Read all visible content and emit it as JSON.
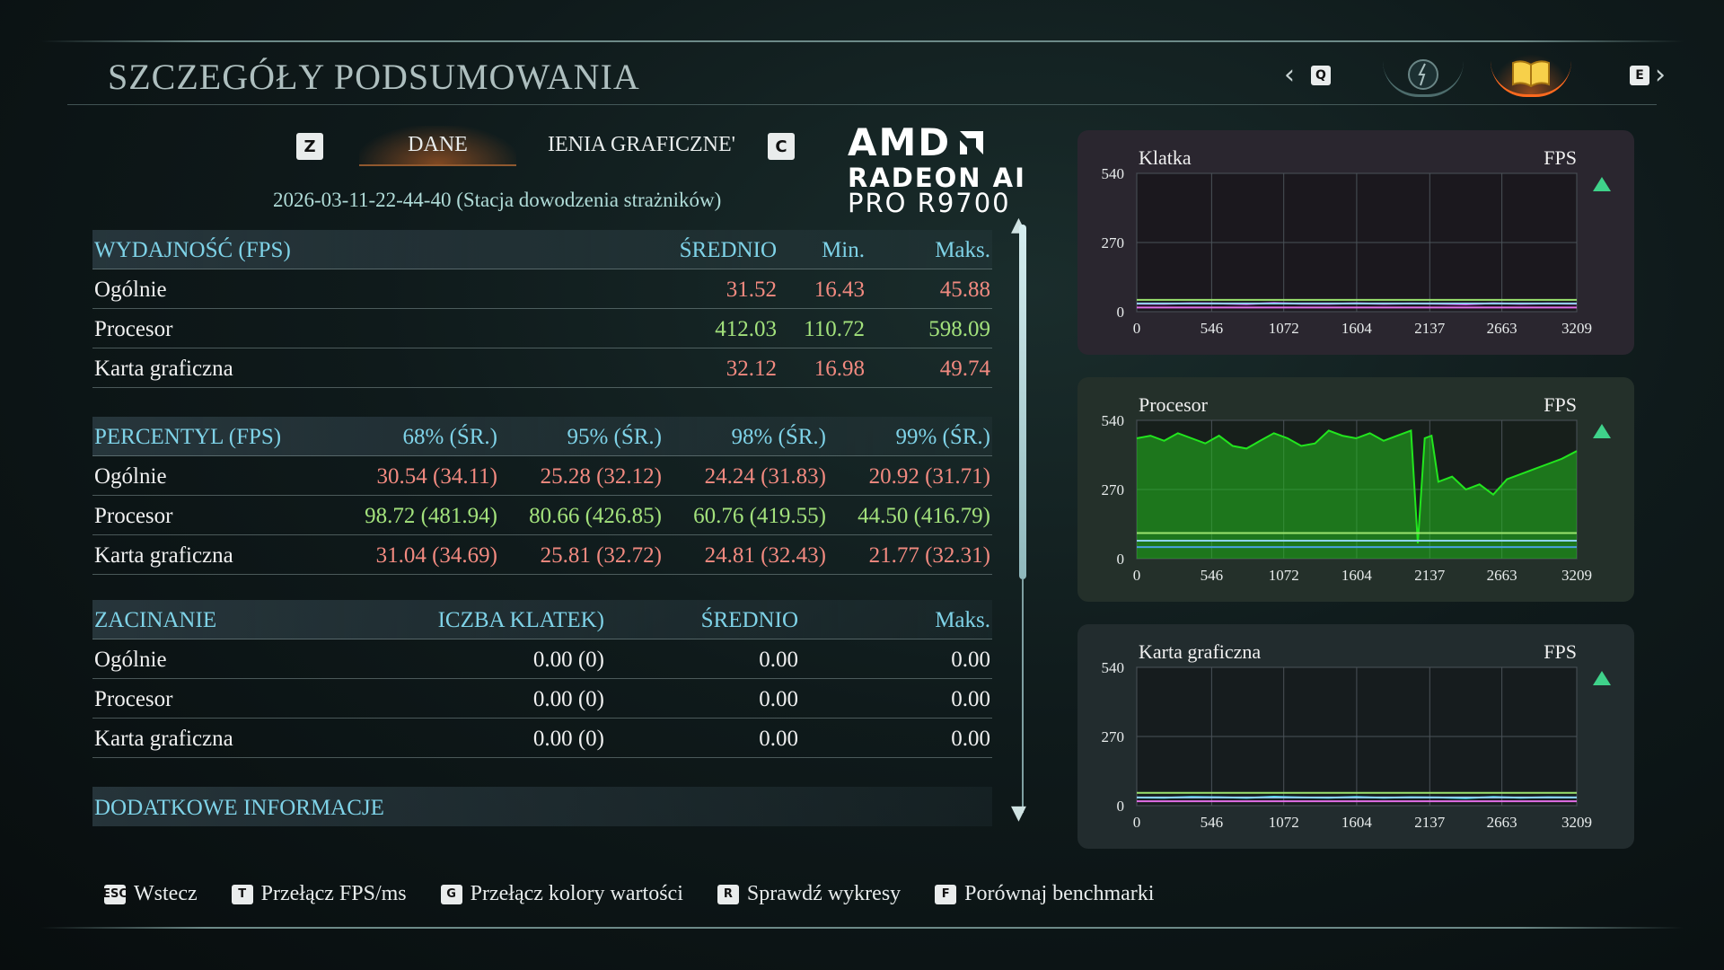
{
  "page_title": "SZCZEGÓŁY PODSUMOWANIA",
  "nav": {
    "prev_key": "Q",
    "next_key": "E"
  },
  "tabs": {
    "prev_key": "Z",
    "next_key": "C",
    "active": "DANE",
    "inactive": "USTAWIENIA GRAFICZNE",
    "inactive_visible": "'IENIA GRAFICZNE"
  },
  "session": "2026-03-11-22-44-40 (Stacja dowodzenia strażników)",
  "logo": {
    "brand": "AMD",
    "line2": "RADEON AI",
    "line3": "PRO R9700"
  },
  "performance": {
    "header": [
      "WYDAJNOŚĆ (FPS)",
      "ŚREDNIO",
      "Min.",
      "Maks."
    ],
    "rows": [
      {
        "label": "Ogólnie",
        "values": [
          "31.52",
          "16.43",
          "45.88"
        ]
      },
      {
        "label": "Procesor",
        "values": [
          "412.03",
          "110.72",
          "598.09"
        ]
      },
      {
        "label": "Karta graficzna",
        "values": [
          "32.12",
          "16.98",
          "49.74"
        ]
      }
    ]
  },
  "percentile": {
    "header": [
      "PERCENTYL (FPS)",
      "68% (ŚR.)",
      "95% (ŚR.)",
      "98% (ŚR.)",
      "99% (ŚR.)"
    ],
    "rows": [
      {
        "label": "Ogólnie",
        "values": [
          "30.54 (34.11)",
          "25.28 (32.12)",
          "24.24 (31.83)",
          "20.92 (31.71)"
        ]
      },
      {
        "label": "Procesor",
        "values": [
          "98.72 (481.94)",
          "80.66 (426.85)",
          "60.76 (419.55)",
          "44.50 (416.79)"
        ]
      },
      {
        "label": "Karta graficzna",
        "values": [
          "31.04 (34.69)",
          "25.81 (32.72)",
          "24.81 (32.43)",
          "21.77 (32.31)"
        ]
      }
    ]
  },
  "stutter": {
    "header": [
      "ZACINANIE",
      "ICZBA KLATEK)",
      "ŚREDNIO",
      "Maks."
    ],
    "rows": [
      {
        "label": "Ogólnie",
        "values": [
          "0.00 (0)",
          "0.00",
          "0.00"
        ]
      },
      {
        "label": "Procesor",
        "values": [
          "0.00 (0)",
          "0.00",
          "0.00"
        ]
      },
      {
        "label": "Karta graficzna",
        "values": [
          "0.00 (0)",
          "0.00",
          "0.00"
        ]
      }
    ]
  },
  "extra_info": "DODATKOWE INFORMACJE",
  "colors": {
    "red": "#f28a80",
    "green": "#a3e27c",
    "header_blue": "#7fd3e8",
    "accent_orange": "#ff6a1f"
  },
  "footer": [
    {
      "key": "ESC",
      "label": "Wstecz"
    },
    {
      "key": "T",
      "label": "Przełącz FPS/ms"
    },
    {
      "key": "G",
      "label": "Przełącz kolory wartości"
    },
    {
      "key": "R",
      "label": "Sprawdź wykresy"
    },
    {
      "key": "F",
      "label": "Porównaj benchmarki"
    }
  ],
  "chart_data": [
    {
      "type": "line",
      "title": "Klatka",
      "ylabel": "FPS",
      "ylim": [
        0,
        540
      ],
      "yticks": [
        "540",
        "270",
        "0"
      ],
      "xticks": [
        "0",
        "546",
        "1072",
        "1604",
        "2137",
        "2663",
        "3209"
      ],
      "xlim": [
        0,
        3209
      ],
      "grid": true,
      "series": [
        {
          "color": "#d23ee0",
          "x": [
            0,
            200,
            400,
            600,
            800,
            1000,
            1200,
            1400,
            1600,
            1800,
            2000,
            2200,
            2400,
            2600,
            2800,
            3000,
            3209
          ],
          "values": [
            31,
            30,
            33,
            32,
            29,
            34,
            31,
            30,
            33,
            30,
            32,
            31,
            28,
            33,
            30,
            32,
            31
          ]
        }
      ],
      "reference_lines": [
        {
          "color": "#9be36e",
          "value": 46
        },
        {
          "color": "#8fd3ff",
          "value": 32
        },
        {
          "color": "#e36ee8",
          "value": 16
        }
      ]
    },
    {
      "type": "line",
      "title": "Procesor",
      "ylabel": "FPS",
      "ylim": [
        0,
        540
      ],
      "yticks": [
        "540",
        "270",
        "0"
      ],
      "xticks": [
        "0",
        "546",
        "1072",
        "1604",
        "2137",
        "2663",
        "3209"
      ],
      "xlim": [
        0,
        3209
      ],
      "grid": true,
      "fill": true,
      "series": [
        {
          "color": "#22e61e",
          "x": [
            0,
            100,
            200,
            300,
            400,
            500,
            600,
            700,
            800,
            900,
            1000,
            1100,
            1200,
            1300,
            1400,
            1500,
            1600,
            1700,
            1800,
            1900,
            2000,
            2050,
            2100,
            2150,
            2200,
            2300,
            2400,
            2500,
            2600,
            2700,
            2800,
            2900,
            3000,
            3100,
            3209
          ],
          "values": [
            470,
            480,
            460,
            490,
            470,
            450,
            480,
            440,
            430,
            460,
            490,
            470,
            440,
            450,
            500,
            480,
            470,
            490,
            460,
            480,
            500,
            60,
            470,
            480,
            300,
            320,
            270,
            290,
            250,
            310,
            330,
            350,
            370,
            390,
            420
          ]
        }
      ],
      "reference_lines": [
        {
          "color": "#9be36e",
          "value": 100
        },
        {
          "color": "#8fd3ff",
          "value": 70
        },
        {
          "color": "#4aa0e0",
          "value": 45
        }
      ]
    },
    {
      "type": "line",
      "title": "Karta graficzna",
      "ylabel": "FPS",
      "ylim": [
        0,
        540
      ],
      "yticks": [
        "540",
        "270",
        "0"
      ],
      "xticks": [
        "0",
        "546",
        "1072",
        "1604",
        "2137",
        "2663",
        "3209"
      ],
      "xlim": [
        0,
        3209
      ],
      "grid": true,
      "series": [
        {
          "color": "#36d7e0",
          "x": [
            0,
            200,
            400,
            600,
            800,
            1000,
            1200,
            1400,
            1600,
            1800,
            2000,
            2200,
            2400,
            2600,
            2800,
            3000,
            3209
          ],
          "values": [
            32,
            31,
            34,
            33,
            30,
            35,
            32,
            31,
            34,
            31,
            33,
            32,
            29,
            34,
            31,
            33,
            32
          ]
        }
      ],
      "reference_lines": [
        {
          "color": "#9be36e",
          "value": 50
        },
        {
          "color": "#8fd3ff",
          "value": 32
        },
        {
          "color": "#e36ee8",
          "value": 17
        }
      ]
    }
  ]
}
